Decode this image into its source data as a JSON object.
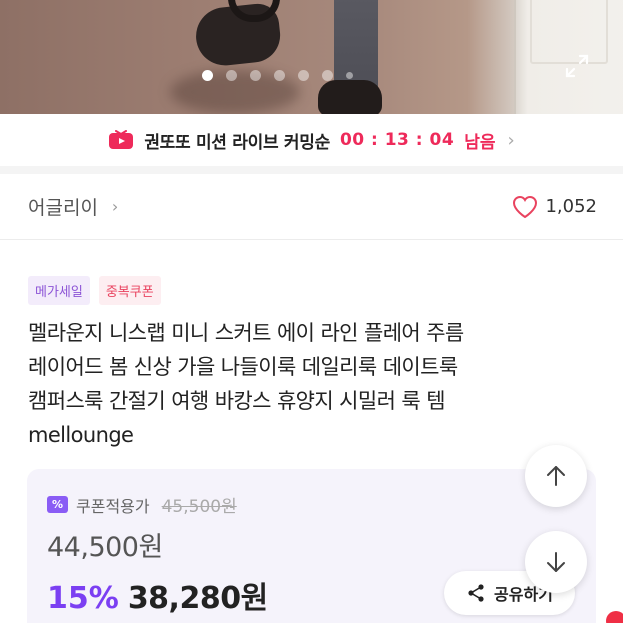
{
  "hero": {
    "carousel_total": 8,
    "carousel_active_index": 0
  },
  "live_banner": {
    "label": "권또또 미션 라이브 커밍순",
    "timer": "00 : 13 : 04",
    "suffix": "남음"
  },
  "store": {
    "name": "어글리이",
    "like_count": "1,052"
  },
  "tags": [
    {
      "label": "메가세일"
    },
    {
      "label": "중복쿠폰"
    }
  ],
  "product": {
    "title_lines": [
      "멜라운지 니스랩 미니 스커트 에이 라인 플레어 주름",
      "레이어드 봄 신상 가을 나들이룩 데일리룩 데이트룩",
      "캠퍼스룩 간절기 여행 바캉스 휴양지 시밀러 룩 템",
      "mellounge"
    ]
  },
  "price": {
    "coupon_icon_text": "%",
    "coupon_label": "쿠폰적용가",
    "original": "45,500원",
    "price": "44,500원",
    "discount": "15%",
    "final": "38,280원"
  },
  "share": {
    "label": "공유하기"
  },
  "colors": {
    "accent_purple": "#7b3ff2",
    "live_red": "#ee2a5a",
    "heart": "#e9435f"
  }
}
